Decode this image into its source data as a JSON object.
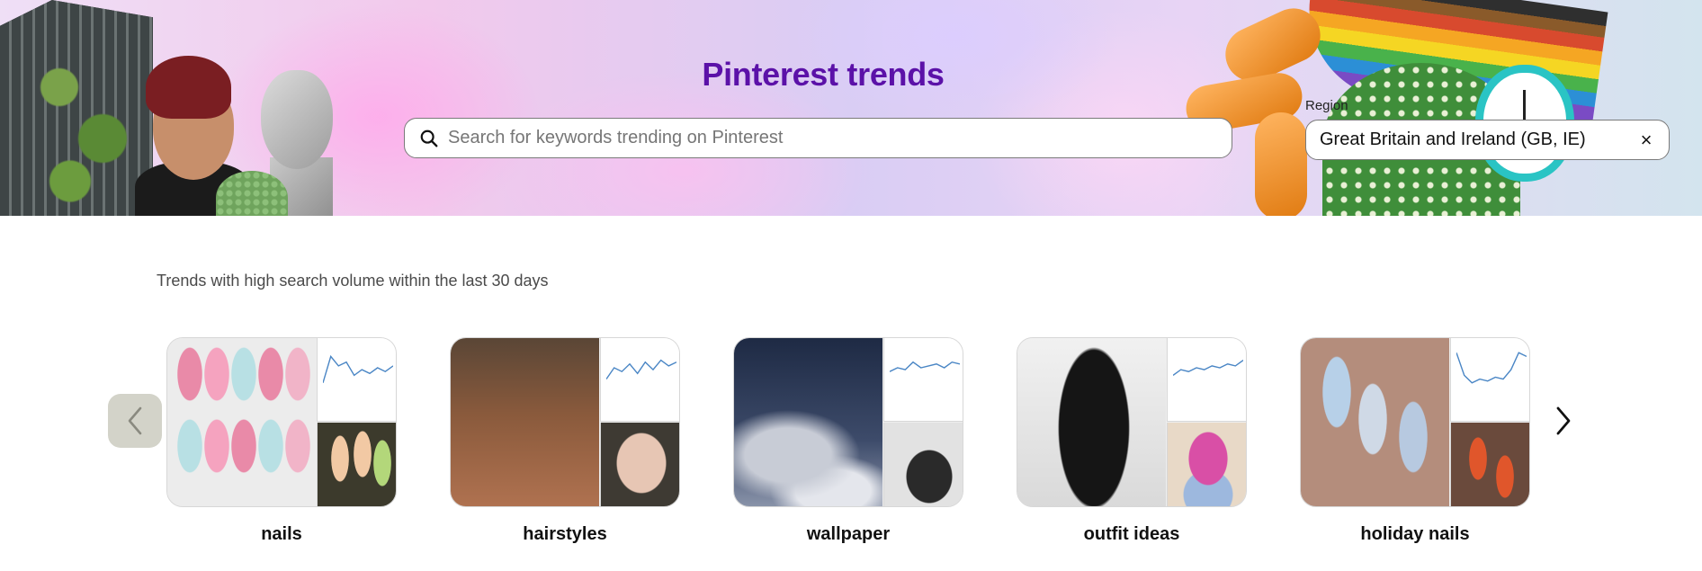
{
  "hero": {
    "title": "Pinterest trends",
    "search": {
      "placeholder": "Search for keywords trending on Pinterest",
      "value": ""
    },
    "region": {
      "label": "Region",
      "value": "Great Britain and Ireland (GB, IE)",
      "clear_icon": "×"
    }
  },
  "main": {
    "subtitle": "Trends with high search volume within the last 30 days",
    "prev_icon": "chevron-left-icon",
    "next_icon": "chevron-right-icon",
    "cards": [
      {
        "label": "nails",
        "sparkline": [
          0.9,
          0.2,
          0.45,
          0.35,
          0.7,
          0.55,
          0.65,
          0.5,
          0.6,
          0.45
        ]
      },
      {
        "label": "hairstyles",
        "sparkline": [
          0.8,
          0.5,
          0.6,
          0.4,
          0.65,
          0.35,
          0.55,
          0.3,
          0.45,
          0.35
        ]
      },
      {
        "label": "wallpaper",
        "sparkline": [
          0.6,
          0.5,
          0.55,
          0.35,
          0.5,
          0.45,
          0.4,
          0.5,
          0.35,
          0.4
        ]
      },
      {
        "label": "outfit ideas",
        "sparkline": [
          0.7,
          0.55,
          0.6,
          0.5,
          0.55,
          0.45,
          0.5,
          0.4,
          0.45,
          0.3
        ]
      },
      {
        "label": "holiday nails",
        "sparkline": [
          0.1,
          0.7,
          0.9,
          0.8,
          0.85,
          0.75,
          0.8,
          0.55,
          0.1,
          0.2
        ]
      }
    ]
  },
  "colors": {
    "title": "#5b11a8",
    "sparkline": "#4a86c5",
    "prev_button_bg": "#d3d3c9"
  }
}
